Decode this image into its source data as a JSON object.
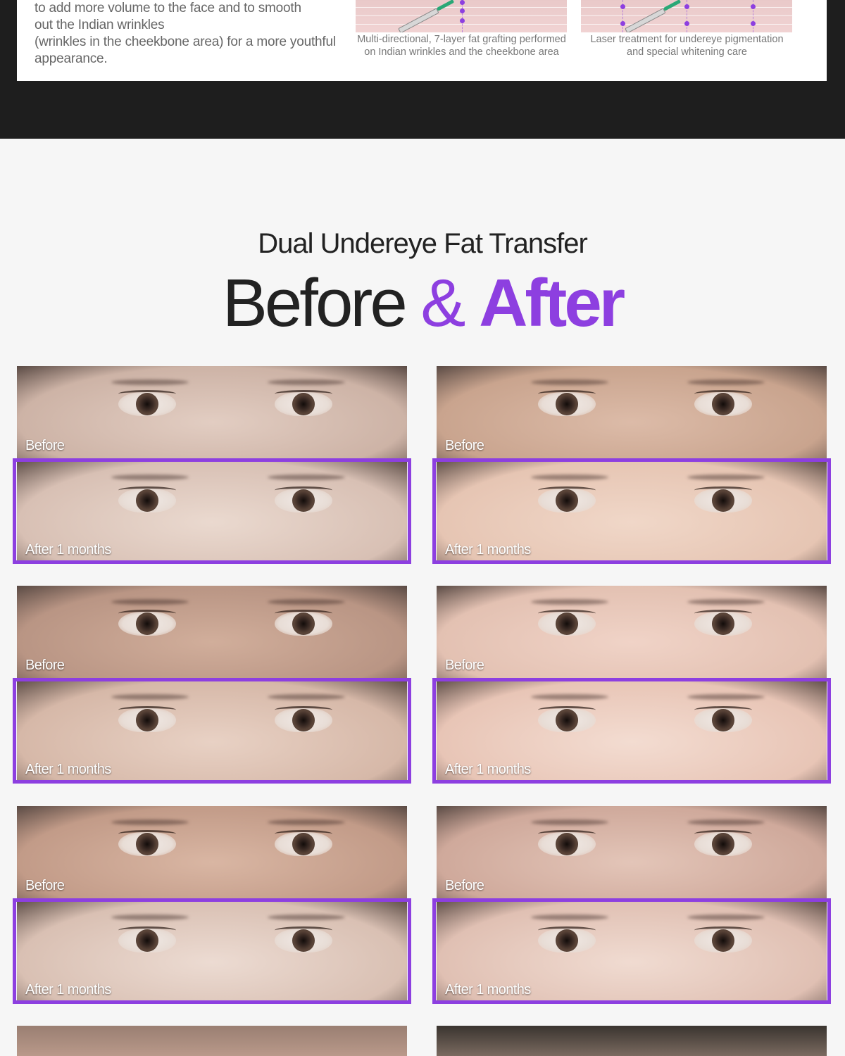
{
  "intro": {
    "text": "to add more volume to the face and to smooth\nout the Indian wrinkles\n(wrinkles in the cheekbone area) for a more youthful\nappearance."
  },
  "illustrations": [
    {
      "caption": "Multi-directional, 7-layer fat grafting performed\non Indian wrinkles and the cheekbone area"
    },
    {
      "caption": "Laser treatment for undereye pigmentation\nand special whitening care"
    }
  ],
  "section": {
    "subtitle": "Dual Undereye Fat Transfer",
    "headline_before": "Before",
    "headline_amp": "&",
    "headline_after": "After"
  },
  "colors": {
    "accent": "#8d3fe0",
    "dark_band": "#1e1e1e",
    "background": "#f6f6f6"
  },
  "cases": [
    {
      "before_label": "Before",
      "after_label": "After 1 months"
    },
    {
      "before_label": "Before",
      "after_label": "After 1 months"
    },
    {
      "before_label": "Before",
      "after_label": "After 1 months"
    },
    {
      "before_label": "Before",
      "after_label": "After 1 months"
    },
    {
      "before_label": "Before",
      "after_label": "After 1 months"
    },
    {
      "before_label": "Before",
      "after_label": "After 1 months"
    }
  ]
}
